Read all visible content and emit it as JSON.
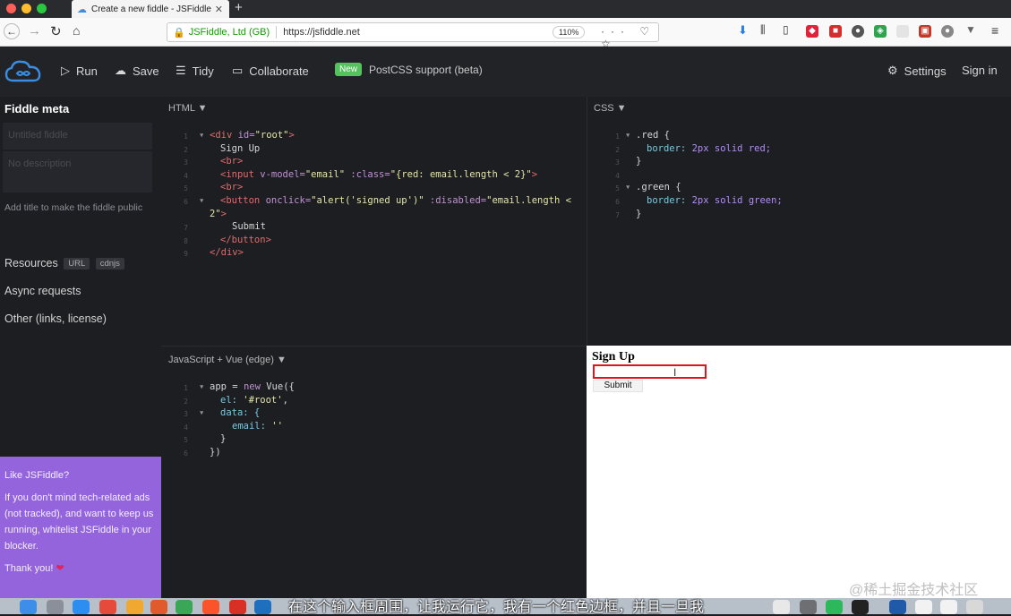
{
  "browser": {
    "tab_title": "Create a new fiddle - JSFiddle",
    "new_tab": "+",
    "site_identity": "JSFiddle, Ltd (GB)",
    "url": "https://jsfiddle.net",
    "zoom": "110%",
    "page_actions": "··· ♡ ☆"
  },
  "header": {
    "run": "Run",
    "save": "Save",
    "tidy": "Tidy",
    "collaborate": "Collaborate",
    "badge": "New",
    "announcement": "PostCSS support (beta)",
    "settings": "Settings",
    "sign_in": "Sign in"
  },
  "sidebar": {
    "title": "Fiddle meta",
    "title_placeholder": "Untitled fiddle",
    "description_placeholder": "No description",
    "hint": "Add title to make the fiddle public",
    "resources": "Resources",
    "chip_url": "URL",
    "chip_cdnjs": "cdnjs",
    "async": "Async requests",
    "other": "Other (links, license)"
  },
  "ad": {
    "heading": "Like JSFiddle?",
    "body": "If you don't mind tech-related ads (not tracked), and want to keep us running, whitelist JSFiddle in your blocker.",
    "thanks": "Thank you!",
    "heart": "❤"
  },
  "panels": {
    "html_label": "HTML",
    "css_label": "CSS",
    "js_label": "JavaScript + Vue (edge)"
  },
  "html_code": {
    "l1a": "<div ",
    "l1b": "id=",
    "l1c": "\"root\"",
    "l1d": ">",
    "l2": "Sign Up",
    "l3": "<br>",
    "l4a": "<input ",
    "l4b": "v-model=",
    "l4c": "\"email\"",
    "l4d": " :class=",
    "l4e": "\"{red: email.length < 2}\"",
    "l4f": ">",
    "l5": "<br>",
    "l6a": "<button ",
    "l6b": "onclick=",
    "l6c": "\"alert('signed up')\"",
    "l6d": " :disabled=",
    "l6e": "\"email.length <",
    "l6f": "2\"",
    "l6g": ">",
    "l7": "Submit",
    "l8": "</button>",
    "l9": "</div>"
  },
  "css_code": {
    "l1": ".red {",
    "l2a": "border: ",
    "l2b": "2px",
    "l2c": " solid ",
    "l2d": "red;",
    "l3": "}",
    "l5": ".green {",
    "l6a": "border: ",
    "l6b": "2px",
    "l6c": " solid ",
    "l6d": "green;",
    "l7": "}"
  },
  "js_code": {
    "l1a": "app = ",
    "l1b": "new",
    "l1c": " Vue({",
    "l2a": "el: ",
    "l2b": "'#root'",
    "l2c": ",",
    "l3": "data: {",
    "l4a": "email: ",
    "l4b": "''",
    "l5": "}",
    "l6": "})"
  },
  "result": {
    "heading": "Sign Up",
    "button": "Submit"
  },
  "overlay": {
    "subtitle": "在这个输入框周围，让我运行它，我有一个红色边框，并且一旦我",
    "watermark": "@稀土掘金技术社区"
  },
  "colors": {
    "accent": "#3a8de0",
    "new_badge": "#55c25e",
    "ad_bg": "#9464dc",
    "invalid_border": "#e0151b"
  }
}
